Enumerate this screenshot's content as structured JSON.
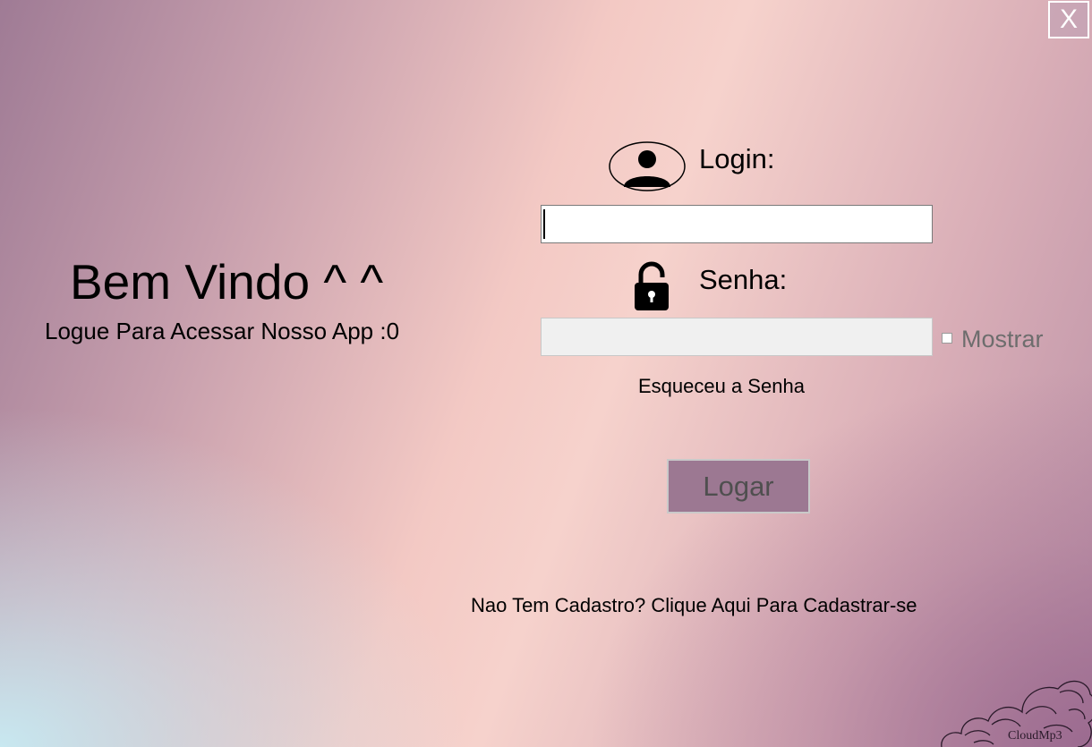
{
  "window": {
    "close_label": "X"
  },
  "welcome": {
    "title": "Bem Vindo ^ ^",
    "subtitle": "Logue Para Acessar Nosso App :0"
  },
  "login": {
    "label": "Login:",
    "icon": "user-icon",
    "value": ""
  },
  "password": {
    "label": "Senha:",
    "icon": "lock-icon",
    "value": "",
    "show_label": "Mostrar",
    "show_checked": false
  },
  "forgot_password": "Esqueceu a Senha",
  "submit_label": "Logar",
  "signup_text": "Nao Tem Cadastro?  Clique Aqui Para Cadastrar-se",
  "brand": {
    "logo_text": "CloudMp3"
  },
  "colors": {
    "button_bg": "#9c7892",
    "button_text": "#4f4f4f",
    "close_border": "#ffffff"
  }
}
